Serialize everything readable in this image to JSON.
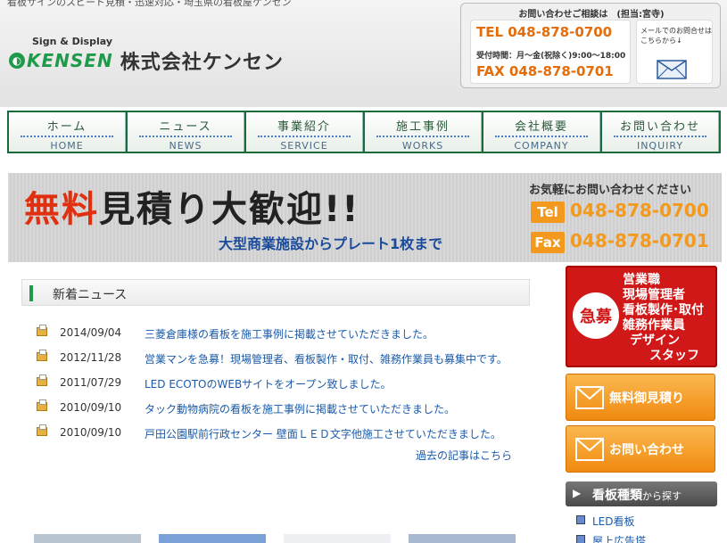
{
  "header": {
    "tagline": "看板サインのスピード見積・迅速対応・埼玉県の看板屋ケンセン",
    "logo_sub": "Sign & Display",
    "logo_brand": "KENSEN",
    "logo_company": "株式会社ケンセン"
  },
  "contact": {
    "heading": "お問い合わせご相談は　(担当:宮寺)",
    "tel": "TEL 048-878-0700",
    "hours": "受付時間：月～金(祝除く)9:00～18:00",
    "fax": "FAX 048-878-0701",
    "mail_text": "メールでのお問合せはこちらから↓"
  },
  "nav": [
    {
      "jp": "ホーム",
      "en": "HOME"
    },
    {
      "jp": "ニュース",
      "en": "NEWS"
    },
    {
      "jp": "事業紹介",
      "en": "SERVICE"
    },
    {
      "jp": "施工事例",
      "en": "WORKS"
    },
    {
      "jp": "会社概要",
      "en": "COMPANY"
    },
    {
      "jp": "お問い合わせ",
      "en": "INQUIRY"
    }
  ],
  "banner": {
    "main_red": "無料",
    "main_dark": "見積り大歓迎!!",
    "sub": "大型商業施設からプレート1枚まで",
    "right_head": "お気軽にお問い合わせください",
    "tel_label": "Tel",
    "tel": "048-878-0700",
    "fax_label": "Fax",
    "fax": "048-878-0701"
  },
  "news": {
    "title": "新着ニュース",
    "items": [
      {
        "date": "2014/09/04",
        "text": "三菱倉庫様の看板を施工事例に掲載させていただきました。"
      },
      {
        "date": "2012/11/28",
        "text": "営業マンを急募！現場管理者、看板製作・取付、雑務作業員も募集中です。"
      },
      {
        "date": "2011/07/29",
        "text": "LED ECOTOのWEBサイトをオープン致しました。"
      },
      {
        "date": "2010/09/10",
        "text": "タック動物病院の看板を施工事例に掲載させていただきました。"
      },
      {
        "date": "2010/09/10",
        "text": "戸田公園駅前行政センター 壁面ＬＥＤ文字他施工させていただきました。"
      }
    ],
    "archive": "過去の記事はこちら"
  },
  "recruit": {
    "badge": "急募",
    "lines": [
      "営業職",
      "現場管理者",
      "看板製作･取付",
      "雑務作業員",
      "デザイン",
      "スタッフ"
    ]
  },
  "buttons": {
    "estimate": "無料御見積り",
    "inquiry": "お問い合わせ"
  },
  "kinds": {
    "title": "看板種類",
    "title_suffix": "から探す",
    "items": [
      "LED看板",
      "屋上広告塔"
    ]
  },
  "colors": {
    "brand_green": "#1e9a4a",
    "accent_orange": "#f08a10",
    "recruit_red": "#d01818",
    "link_blue": "#1a5aaa"
  }
}
